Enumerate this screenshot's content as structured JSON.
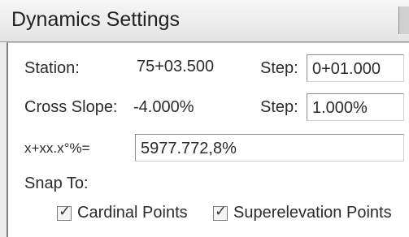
{
  "window": {
    "title": "Dynamics Settings"
  },
  "station": {
    "label": "Station:",
    "value": "75+03.500",
    "step_label": "Step:",
    "step_value": "0+01.000"
  },
  "cross_slope": {
    "label": "Cross Slope:",
    "value": "-4.000%",
    "step_label": "Step:",
    "step_value": "1.000%"
  },
  "formula": {
    "label": "x+xx.x°%=",
    "value": "5977.772,8%"
  },
  "snap": {
    "label": "Snap To:",
    "options": [
      {
        "label": "Cardinal Points",
        "checked": true
      },
      {
        "label": "Superelevation Points",
        "checked": true
      }
    ]
  }
}
